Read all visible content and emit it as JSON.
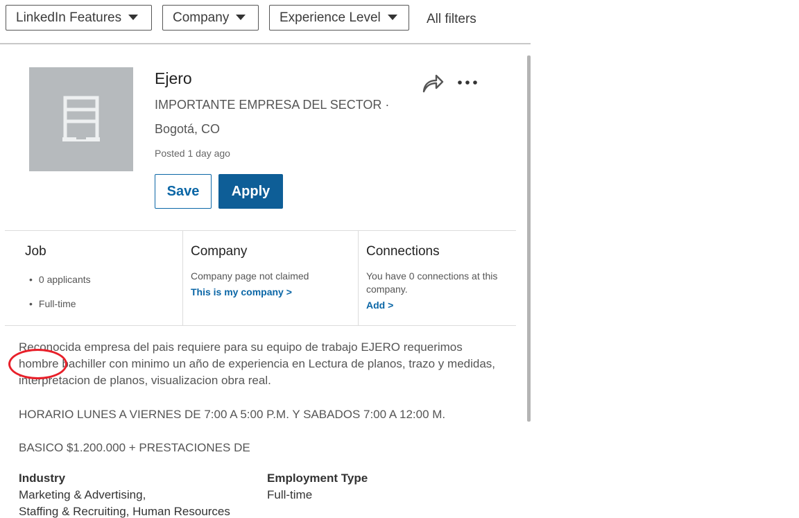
{
  "filters": {
    "linkedin_features": "LinkedIn Features",
    "company": "Company",
    "experience_level": "Experience Level",
    "all_filters": "All filters"
  },
  "job": {
    "title": "Ejero",
    "company": "IMPORTANTE EMPRESA DEL SECTOR ·",
    "location": "Bogotá, CO",
    "posted": "Posted 1 day ago",
    "save_label": "Save",
    "apply_label": "Apply"
  },
  "info": {
    "job": {
      "heading": "Job",
      "applicants": "0 applicants",
      "type": "Full-time"
    },
    "company": {
      "heading": "Company",
      "status": "Company page not claimed",
      "link": "This is my company >"
    },
    "connections": {
      "heading": "Connections",
      "text": "You have 0 connections at this company.",
      "link": "Add >"
    }
  },
  "description": {
    "para1": "Reconocida empresa del pais requiere para su equipo de trabajo EJERO requerimos hombre bachiller con minimo un año de experiencia en Lectura de planos, trazo y medidas, interpretacion de planos, visualizacion obra real.",
    "para2": "HORARIO LUNES A VIERNES DE 7:00 A 5:00 P.M. Y SABADOS 7:00 A 12:00 M.",
    "para3": "BASICO $1.200.000 + PRESTACIONES DE"
  },
  "criteria": {
    "industry_label": "Industry",
    "industry_line1": "Marketing & Advertising,",
    "industry_line2": "Staffing & Recruiting, Human Resources",
    "employment_label": "Employment Type",
    "employment_value": "Full-time"
  },
  "colors": {
    "brand_blue": "#0a66a6",
    "annotation_red": "#e8202a"
  },
  "icons": {
    "share": "share-arrow-icon",
    "more": "more-dots-icon",
    "logo": "building-icon"
  }
}
